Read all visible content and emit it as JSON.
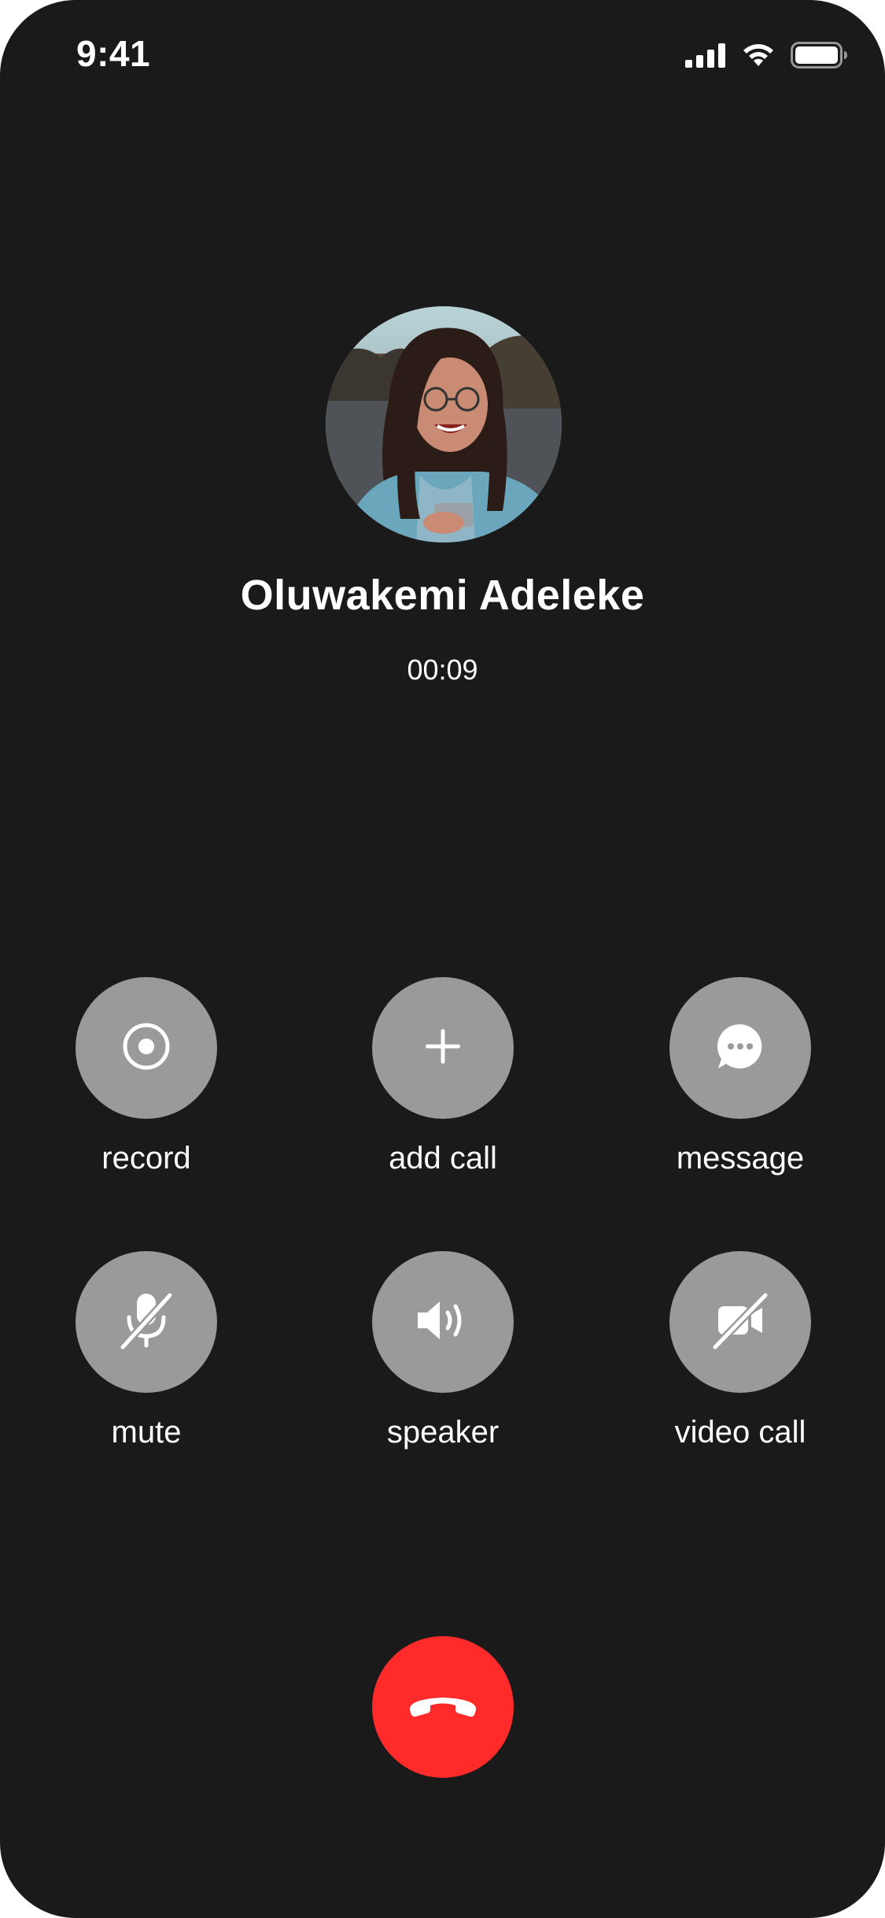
{
  "status_bar": {
    "time": "9:41",
    "icons": [
      "cellular-signal-icon",
      "wifi-icon",
      "battery-icon"
    ]
  },
  "caller": {
    "name": "Oluwakemi Adeleke",
    "duration": "00:09"
  },
  "actions": [
    {
      "label": "record",
      "icon": "record-icon"
    },
    {
      "label": "add call",
      "icon": "plus-icon"
    },
    {
      "label": "message",
      "icon": "message-bubble-icon"
    },
    {
      "label": "mute",
      "icon": "microphone-off-icon"
    },
    {
      "label": "speaker",
      "icon": "speaker-icon"
    },
    {
      "label": "video call",
      "icon": "video-off-icon"
    }
  ],
  "end_call": {
    "icon": "phone-hangup-icon"
  },
  "colors": {
    "background": "#1a1a1a",
    "action_button": "#9a9a9a",
    "end_call": "#ff2a2a",
    "text": "#ffffff"
  }
}
